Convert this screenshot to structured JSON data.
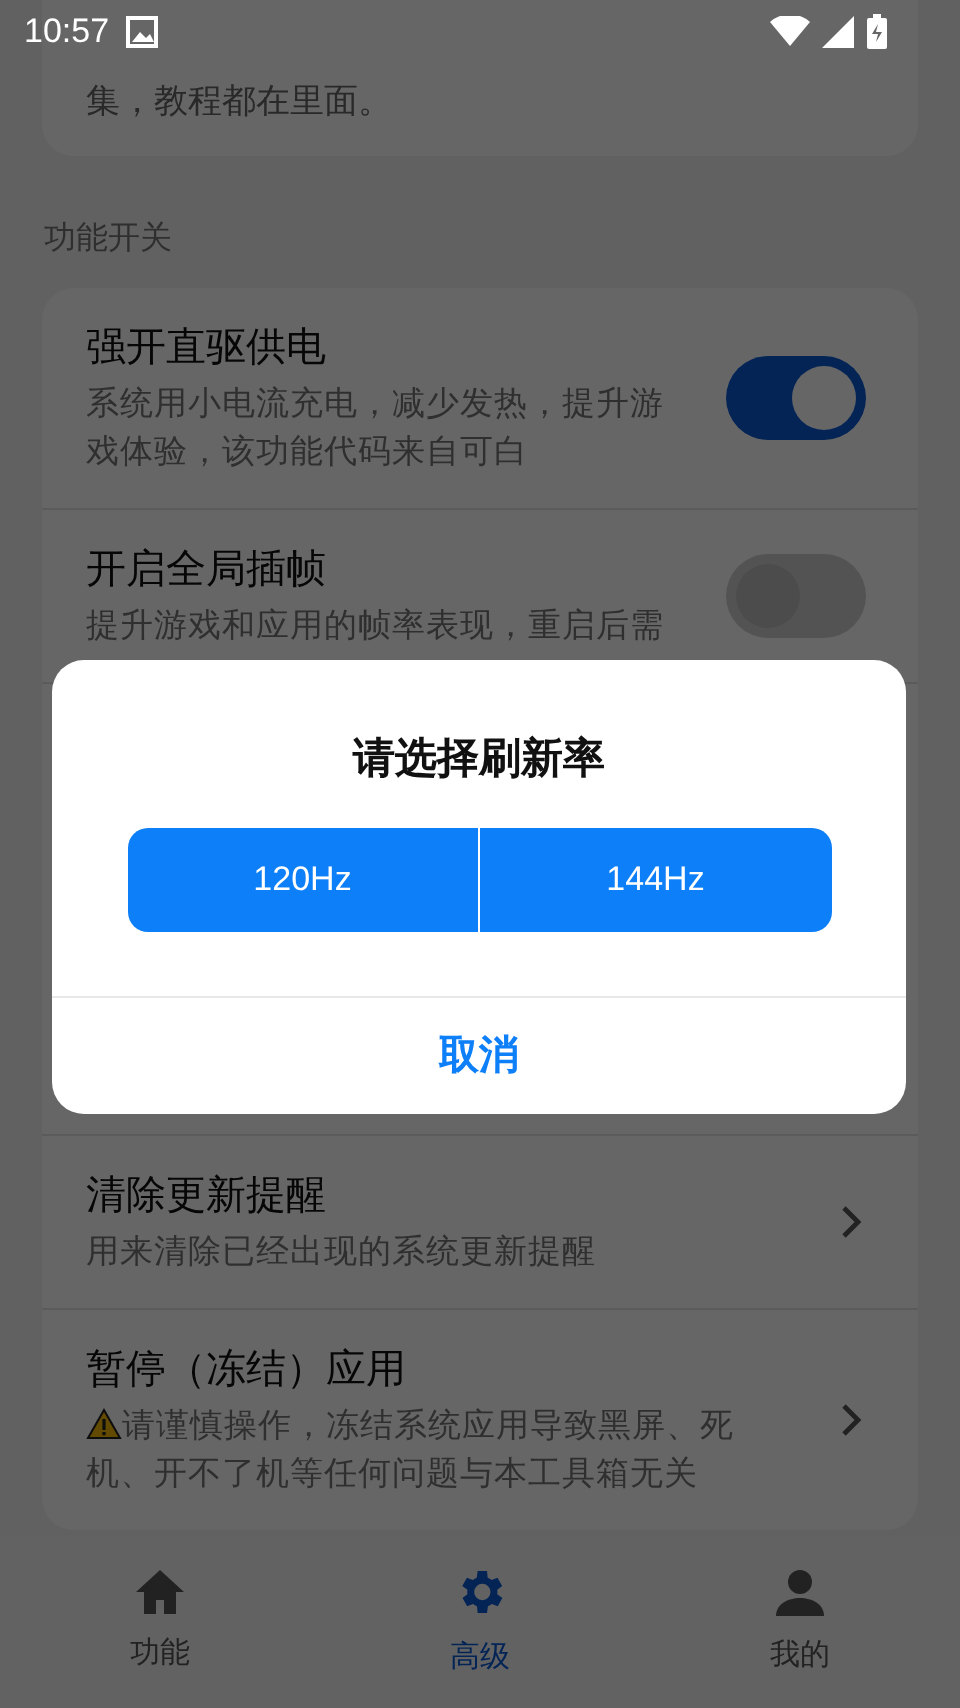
{
  "status_bar": {
    "time": "10:57"
  },
  "intro_card": {
    "text": "集，教程都在里面。"
  },
  "section": {
    "title": "功能开关"
  },
  "items": [
    {
      "kind": "toggle",
      "title": "强开直驱供电",
      "description": "系统用小电流充电，减少发热，提升游戏体验，该功能代码来自可白",
      "on": true
    },
    {
      "kind": "toggle",
      "title": "开启全局插帧",
      "description": "提升游戏和应用的帧率表现，重启后需",
      "on": false
    },
    {
      "kind": "link",
      "title": "清除更新提醒",
      "description": "用来清除已经出现的系统更新提醒",
      "warning": false
    },
    {
      "kind": "link",
      "title": "暂停（冻结）应用",
      "description": "请谨慎操作，冻结系统应用导致黑屏、死机、开不了机等任何问题与本工具箱无关",
      "warning": true
    }
  ],
  "dialog": {
    "title": "请选择刷新率",
    "options": [
      "120Hz",
      "144Hz"
    ],
    "cancel": "取消"
  },
  "nav": [
    {
      "label": "功能",
      "selected": false
    },
    {
      "label": "高级",
      "selected": true
    },
    {
      "label": "我的",
      "selected": false
    }
  ]
}
